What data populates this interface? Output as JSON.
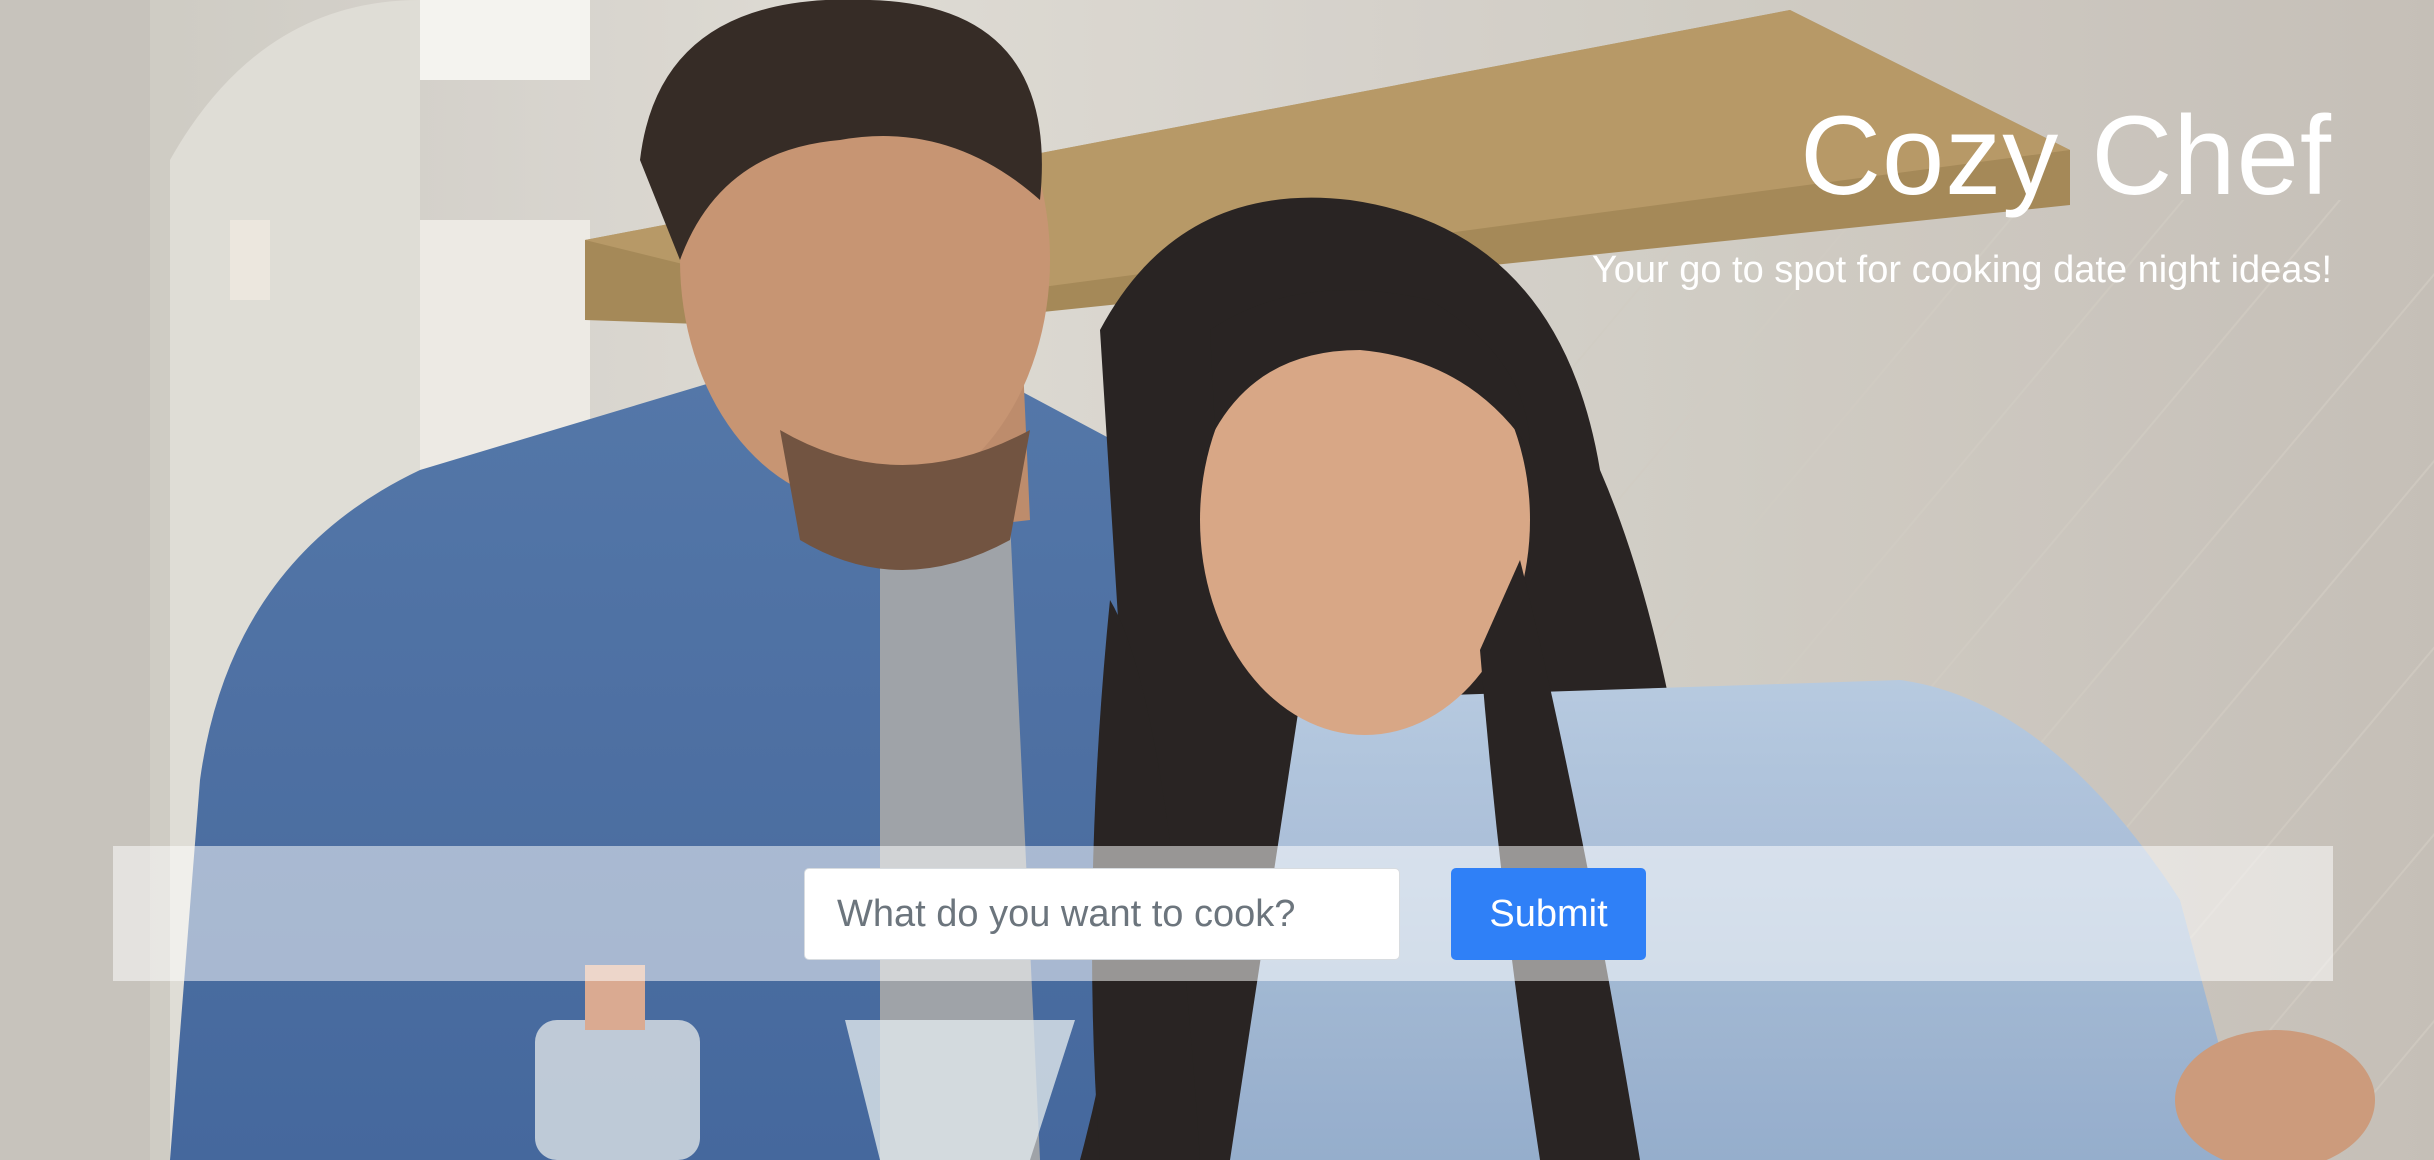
{
  "header": {
    "title": "Cozy Chef",
    "subtitle": "Your go to spot for cooking date night ideas!"
  },
  "search": {
    "placeholder": "What do you want to cook?",
    "value": ""
  },
  "submit": {
    "label": "Submit"
  },
  "colors": {
    "accent": "#2f80f7",
    "title_text": "#ffffff"
  }
}
